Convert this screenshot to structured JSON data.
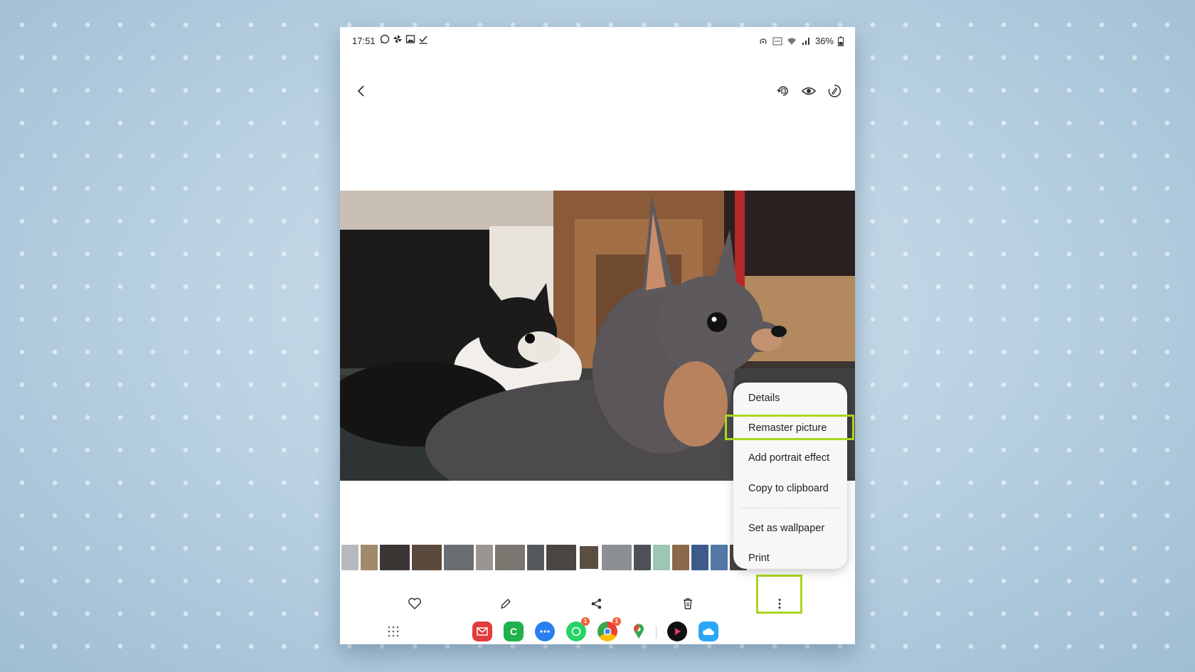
{
  "status_bar": {
    "time": "17:51",
    "notification_icons": [
      "whatsapp-icon",
      "pinwheel-icon",
      "image-icon",
      "check-icon"
    ],
    "battery_percent": "36%",
    "right_icons": [
      "hotspot-icon",
      "volte-icon",
      "wifi-icon",
      "signal-icon",
      "battery-icon"
    ]
  },
  "top_bar": {
    "icons": [
      "back-arrow-icon",
      "rotate-icon",
      "eye-icon",
      "remaster-icon"
    ]
  },
  "photo": {
    "subject": "two chihuahua dogs"
  },
  "context_menu": {
    "items": [
      "Details",
      "Remaster picture",
      "Add portrait effect",
      "Copy to clipboard",
      "Set as wallpaper",
      "Print"
    ],
    "highlighted": "Remaster picture"
  },
  "bottom_actions": {
    "icons": [
      "heart-icon",
      "pencil-icon",
      "share-icon",
      "trash-icon",
      "more-options-icon"
    ]
  },
  "dock": {
    "apps": [
      {
        "name": "app-drawer-icon",
        "color": "#666666"
      },
      {
        "name": "email-icon",
        "color": "#e23b3b"
      },
      {
        "name": "phone-icon",
        "color": "#1fb14c"
      },
      {
        "name": "messages-icon",
        "color": "#2a7ff0"
      },
      {
        "name": "whatsapp-icon",
        "color": "#25d366",
        "badge": "1"
      },
      {
        "name": "chrome-icon",
        "color": "#ea4335",
        "badge": "1"
      },
      {
        "name": "maps-icon",
        "color": "#34a853"
      },
      {
        "name": "video-player-icon",
        "color": "#111111"
      },
      {
        "name": "weather-icon",
        "color": "#2aa7f5"
      }
    ]
  },
  "colors": {
    "highlight": "#a9d620",
    "menu_background": "#f7f7f7"
  }
}
